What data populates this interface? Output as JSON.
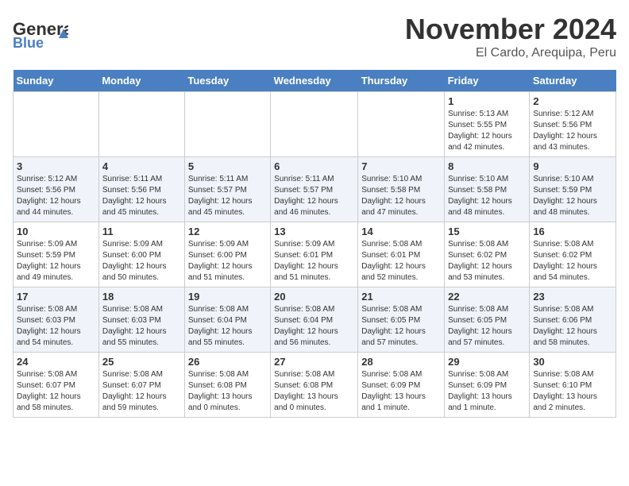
{
  "logo": {
    "general": "General",
    "blue": "Blue"
  },
  "title": "November 2024",
  "subtitle": "El Cardo, Arequipa, Peru",
  "days_of_week": [
    "Sunday",
    "Monday",
    "Tuesday",
    "Wednesday",
    "Thursday",
    "Friday",
    "Saturday"
  ],
  "weeks": [
    [
      {
        "day": "",
        "info": ""
      },
      {
        "day": "",
        "info": ""
      },
      {
        "day": "",
        "info": ""
      },
      {
        "day": "",
        "info": ""
      },
      {
        "day": "",
        "info": ""
      },
      {
        "day": "1",
        "info": "Sunrise: 5:13 AM\nSunset: 5:55 PM\nDaylight: 12 hours\nand 42 minutes."
      },
      {
        "day": "2",
        "info": "Sunrise: 5:12 AM\nSunset: 5:56 PM\nDaylight: 12 hours\nand 43 minutes."
      }
    ],
    [
      {
        "day": "3",
        "info": "Sunrise: 5:12 AM\nSunset: 5:56 PM\nDaylight: 12 hours\nand 44 minutes."
      },
      {
        "day": "4",
        "info": "Sunrise: 5:11 AM\nSunset: 5:56 PM\nDaylight: 12 hours\nand 45 minutes."
      },
      {
        "day": "5",
        "info": "Sunrise: 5:11 AM\nSunset: 5:57 PM\nDaylight: 12 hours\nand 45 minutes."
      },
      {
        "day": "6",
        "info": "Sunrise: 5:11 AM\nSunset: 5:57 PM\nDaylight: 12 hours\nand 46 minutes."
      },
      {
        "day": "7",
        "info": "Sunrise: 5:10 AM\nSunset: 5:58 PM\nDaylight: 12 hours\nand 47 minutes."
      },
      {
        "day": "8",
        "info": "Sunrise: 5:10 AM\nSunset: 5:58 PM\nDaylight: 12 hours\nand 48 minutes."
      },
      {
        "day": "9",
        "info": "Sunrise: 5:10 AM\nSunset: 5:59 PM\nDaylight: 12 hours\nand 48 minutes."
      }
    ],
    [
      {
        "day": "10",
        "info": "Sunrise: 5:09 AM\nSunset: 5:59 PM\nDaylight: 12 hours\nand 49 minutes."
      },
      {
        "day": "11",
        "info": "Sunrise: 5:09 AM\nSunset: 6:00 PM\nDaylight: 12 hours\nand 50 minutes."
      },
      {
        "day": "12",
        "info": "Sunrise: 5:09 AM\nSunset: 6:00 PM\nDaylight: 12 hours\nand 51 minutes."
      },
      {
        "day": "13",
        "info": "Sunrise: 5:09 AM\nSunset: 6:01 PM\nDaylight: 12 hours\nand 51 minutes."
      },
      {
        "day": "14",
        "info": "Sunrise: 5:08 AM\nSunset: 6:01 PM\nDaylight: 12 hours\nand 52 minutes."
      },
      {
        "day": "15",
        "info": "Sunrise: 5:08 AM\nSunset: 6:02 PM\nDaylight: 12 hours\nand 53 minutes."
      },
      {
        "day": "16",
        "info": "Sunrise: 5:08 AM\nSunset: 6:02 PM\nDaylight: 12 hours\nand 54 minutes."
      }
    ],
    [
      {
        "day": "17",
        "info": "Sunrise: 5:08 AM\nSunset: 6:03 PM\nDaylight: 12 hours\nand 54 minutes."
      },
      {
        "day": "18",
        "info": "Sunrise: 5:08 AM\nSunset: 6:03 PM\nDaylight: 12 hours\nand 55 minutes."
      },
      {
        "day": "19",
        "info": "Sunrise: 5:08 AM\nSunset: 6:04 PM\nDaylight: 12 hours\nand 55 minutes."
      },
      {
        "day": "20",
        "info": "Sunrise: 5:08 AM\nSunset: 6:04 PM\nDaylight: 12 hours\nand 56 minutes."
      },
      {
        "day": "21",
        "info": "Sunrise: 5:08 AM\nSunset: 6:05 PM\nDaylight: 12 hours\nand 57 minutes."
      },
      {
        "day": "22",
        "info": "Sunrise: 5:08 AM\nSunset: 6:05 PM\nDaylight: 12 hours\nand 57 minutes."
      },
      {
        "day": "23",
        "info": "Sunrise: 5:08 AM\nSunset: 6:06 PM\nDaylight: 12 hours\nand 58 minutes."
      }
    ],
    [
      {
        "day": "24",
        "info": "Sunrise: 5:08 AM\nSunset: 6:07 PM\nDaylight: 12 hours\nand 58 minutes."
      },
      {
        "day": "25",
        "info": "Sunrise: 5:08 AM\nSunset: 6:07 PM\nDaylight: 12 hours\nand 59 minutes."
      },
      {
        "day": "26",
        "info": "Sunrise: 5:08 AM\nSunset: 6:08 PM\nDaylight: 13 hours\nand 0 minutes."
      },
      {
        "day": "27",
        "info": "Sunrise: 5:08 AM\nSunset: 6:08 PM\nDaylight: 13 hours\nand 0 minutes."
      },
      {
        "day": "28",
        "info": "Sunrise: 5:08 AM\nSunset: 6:09 PM\nDaylight: 13 hours\nand 1 minute."
      },
      {
        "day": "29",
        "info": "Sunrise: 5:08 AM\nSunset: 6:09 PM\nDaylight: 13 hours\nand 1 minute."
      },
      {
        "day": "30",
        "info": "Sunrise: 5:08 AM\nSunset: 6:10 PM\nDaylight: 13 hours\nand 2 minutes."
      }
    ]
  ]
}
